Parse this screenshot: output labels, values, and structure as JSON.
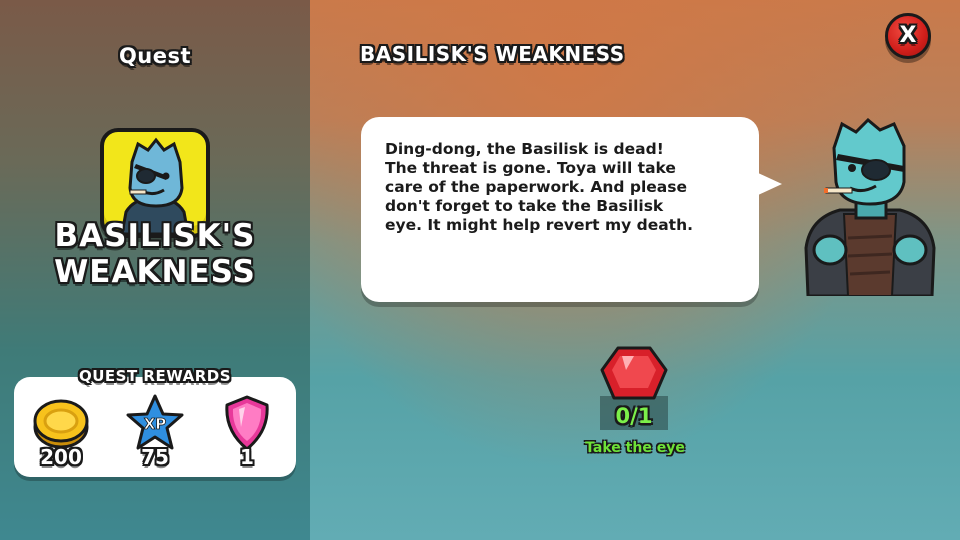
{
  "left_panel": {
    "section_label": "Quest",
    "quest_title": "BASILISK'S WEAKNESS",
    "rewards_heading": "QUEST REWARDS",
    "rewards": [
      {
        "icon": "gold-coin-icon",
        "count": "200"
      },
      {
        "icon": "xp-star-icon",
        "icon_text": "XP",
        "count": "75"
      },
      {
        "icon": "pink-gem-shield-icon",
        "count": "1"
      }
    ]
  },
  "dialog": {
    "title": "BASILISK'S WEAKNESS",
    "speech": "Ding-dong, the Basilisk is dead!\nThe threat is gone. Toya will take\ncare of the paperwork. And please\ndon't forget to take the Basilisk\neye. It might help revert my death.",
    "close_label": "X"
  },
  "objective": {
    "icon": "red-gem-eye-icon",
    "progress": "0/1",
    "label": "Take the eye"
  },
  "colors": {
    "quest_icon_bg": "#f2e61a",
    "close_button": "#d01e1a",
    "objective_text": "#7cf04a"
  }
}
